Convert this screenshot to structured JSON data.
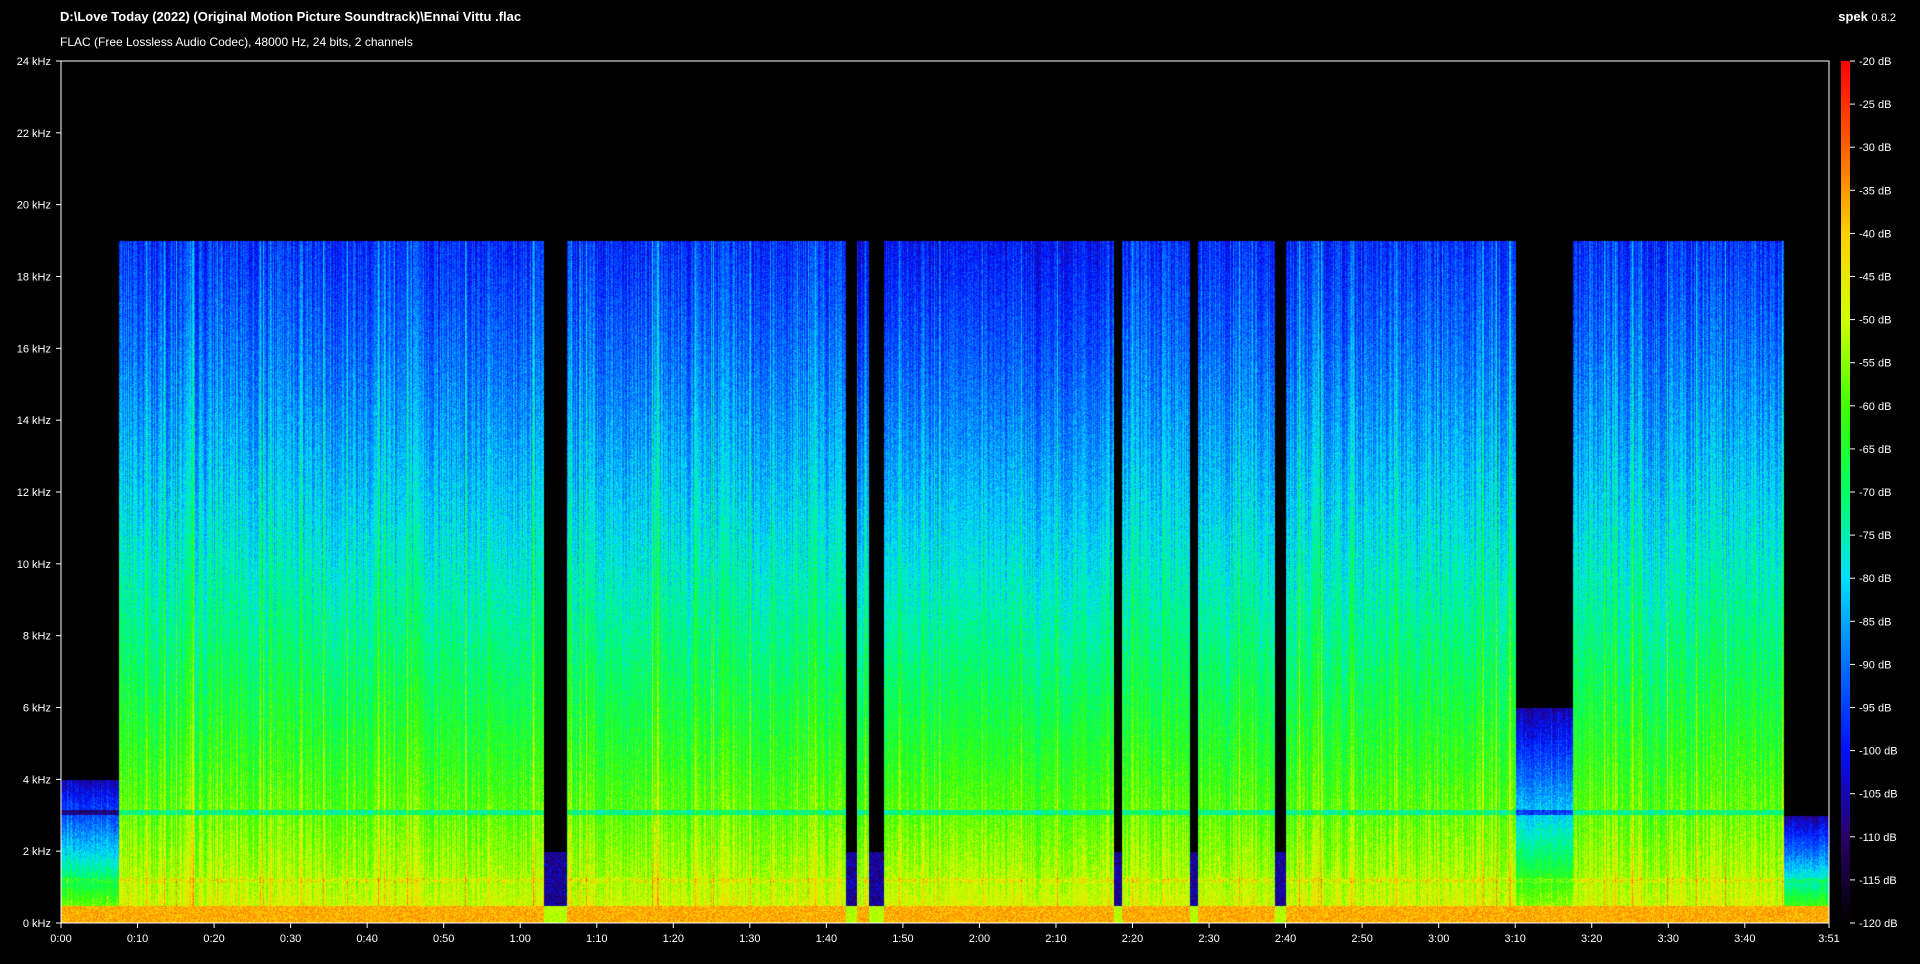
{
  "header": {
    "file_path": "D:\\Love Today (2022) (Original Motion Picture Soundtrack)\\Ennai Vittu .flac",
    "file_info": "FLAC (Free Lossless Audio Codec), 48000 Hz, 24 bits, 2 channels",
    "app_name": "spek",
    "app_version": "0.8.2"
  },
  "chart_data": {
    "type": "heatmap",
    "x": {
      "unit": "time",
      "range_seconds": [
        0,
        231
      ],
      "ticks": [
        {
          "value": 0,
          "label": "0:00"
        },
        {
          "value": 10,
          "label": "0:10"
        },
        {
          "value": 20,
          "label": "0:20"
        },
        {
          "value": 30,
          "label": "0:30"
        },
        {
          "value": 40,
          "label": "0:40"
        },
        {
          "value": 50,
          "label": "0:50"
        },
        {
          "value": 60,
          "label": "1:00"
        },
        {
          "value": 70,
          "label": "1:10"
        },
        {
          "value": 80,
          "label": "1:20"
        },
        {
          "value": 90,
          "label": "1:30"
        },
        {
          "value": 100,
          "label": "1:40"
        },
        {
          "value": 110,
          "label": "1:50"
        },
        {
          "value": 120,
          "label": "2:00"
        },
        {
          "value": 130,
          "label": "2:10"
        },
        {
          "value": 140,
          "label": "2:20"
        },
        {
          "value": 150,
          "label": "2:30"
        },
        {
          "value": 160,
          "label": "2:40"
        },
        {
          "value": 170,
          "label": "2:50"
        },
        {
          "value": 180,
          "label": "3:00"
        },
        {
          "value": 190,
          "label": "3:10"
        },
        {
          "value": 200,
          "label": "3:20"
        },
        {
          "value": 210,
          "label": "3:30"
        },
        {
          "value": 220,
          "label": "3:40"
        },
        {
          "value": 231,
          "label": "3:51"
        }
      ]
    },
    "y": {
      "unit": "kHz",
      "range": [
        0,
        24
      ],
      "ticks": [
        {
          "value": 0,
          "label": "0 kHz"
        },
        {
          "value": 2,
          "label": "2 kHz"
        },
        {
          "value": 4,
          "label": "4 kHz"
        },
        {
          "value": 6,
          "label": "6 kHz"
        },
        {
          "value": 8,
          "label": "8 kHz"
        },
        {
          "value": 10,
          "label": "10 kHz"
        },
        {
          "value": 12,
          "label": "12 kHz"
        },
        {
          "value": 14,
          "label": "14 kHz"
        },
        {
          "value": 16,
          "label": "16 kHz"
        },
        {
          "value": 18,
          "label": "18 kHz"
        },
        {
          "value": 20,
          "label": "20 kHz"
        },
        {
          "value": 22,
          "label": "22 kHz"
        },
        {
          "value": 24,
          "label": "24 kHz"
        }
      ]
    },
    "color_scale": {
      "unit": "dB",
      "range": [
        -120,
        -20
      ],
      "ticks": [
        {
          "value": -20,
          "label": "-20 dB"
        },
        {
          "value": -25,
          "label": "-25 dB"
        },
        {
          "value": -30,
          "label": "-30 dB"
        },
        {
          "value": -35,
          "label": "-35 dB"
        },
        {
          "value": -40,
          "label": "-40 dB"
        },
        {
          "value": -45,
          "label": "-45 dB"
        },
        {
          "value": -50,
          "label": "-50 dB"
        },
        {
          "value": -55,
          "label": "-55 dB"
        },
        {
          "value": -60,
          "label": "-60 dB"
        },
        {
          "value": -65,
          "label": "-65 dB"
        },
        {
          "value": -70,
          "label": "-70 dB"
        },
        {
          "value": -75,
          "label": "-75 dB"
        },
        {
          "value": -80,
          "label": "-80 dB"
        },
        {
          "value": -85,
          "label": "-85 dB"
        },
        {
          "value": -90,
          "label": "-90 dB"
        },
        {
          "value": -95,
          "label": "-95 dB"
        },
        {
          "value": -100,
          "label": "-100 dB"
        },
        {
          "value": -105,
          "label": "-105 dB"
        },
        {
          "value": -110,
          "label": "-110 dB"
        },
        {
          "value": -115,
          "label": "-115 dB"
        },
        {
          "value": -120,
          "label": "-120 dB"
        }
      ],
      "stops": [
        {
          "db": -120,
          "color": "#000000"
        },
        {
          "db": -110,
          "color": "#2a0066"
        },
        {
          "db": -100,
          "color": "#0010ff"
        },
        {
          "db": -90,
          "color": "#0070ff"
        },
        {
          "db": -80,
          "color": "#00e0ff"
        },
        {
          "db": -70,
          "color": "#00ff60"
        },
        {
          "db": -60,
          "color": "#40ff00"
        },
        {
          "db": -50,
          "color": "#d0ff00"
        },
        {
          "db": -40,
          "color": "#ffd000"
        },
        {
          "db": -30,
          "color": "#ff6000"
        },
        {
          "db": -20,
          "color": "#ff0000"
        }
      ]
    },
    "content_cutoff_khz": 19,
    "segments": [
      {
        "start": 7.5,
        "end": 63,
        "top_khz": 19,
        "intensity": 0.85
      },
      {
        "start": 66,
        "end": 102.5,
        "top_khz": 19,
        "intensity": 0.85
      },
      {
        "start": 104,
        "end": 105.5,
        "top_khz": 19,
        "intensity": 0.6
      },
      {
        "start": 107.5,
        "end": 137.5,
        "top_khz": 19,
        "intensity": 0.65
      },
      {
        "start": 138.5,
        "end": 147.5,
        "top_khz": 19,
        "intensity": 0.85
      },
      {
        "start": 148.5,
        "end": 158.5,
        "top_khz": 19,
        "intensity": 0.85
      },
      {
        "start": 160,
        "end": 190,
        "top_khz": 19,
        "intensity": 0.85
      },
      {
        "start": 197.5,
        "end": 225,
        "top_khz": 19,
        "intensity": 0.85
      }
    ],
    "quiet_regions": [
      {
        "start": 0,
        "end": 7.5,
        "top_khz": 4,
        "intensity": 0.35
      },
      {
        "start": 190,
        "end": 197.5,
        "top_khz": 6,
        "intensity": 0.3
      },
      {
        "start": 225,
        "end": 231,
        "top_khz": 3,
        "intensity": 0.3
      }
    ]
  }
}
